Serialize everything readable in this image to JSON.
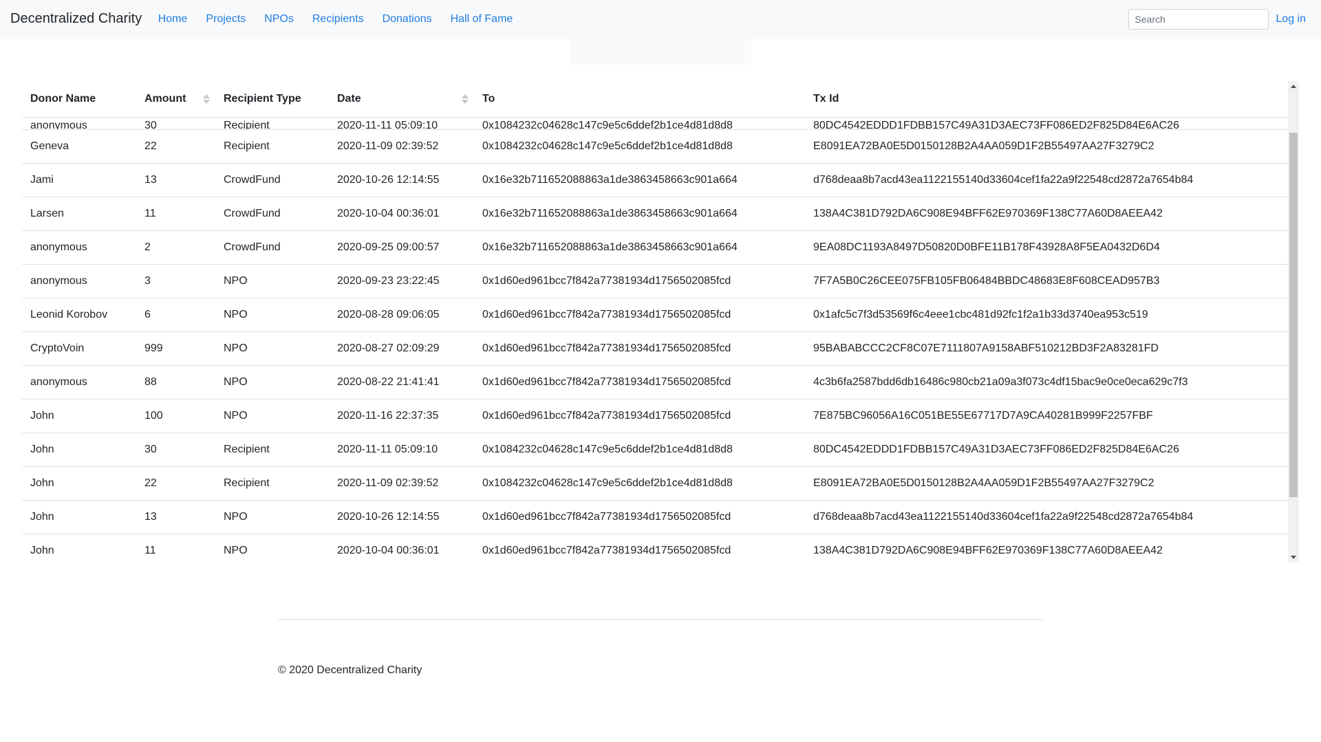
{
  "nav": {
    "brand": "Decentralized Charity",
    "links": [
      "Home",
      "Projects",
      "NPOs",
      "Recipients",
      "Donations",
      "Hall of Fame"
    ],
    "search_placeholder": "Search",
    "login": "Log in"
  },
  "table": {
    "headers": [
      "Donor Name",
      "Amount",
      "Recipient Type",
      "Date",
      "To",
      "Tx Id"
    ],
    "partial_row": [
      "anonymous",
      "30",
      "Recipient",
      "2020-11-11 05:09:10",
      "0x1084232c04628c147c9e5c6ddef2b1ce4d81d8d8",
      "80DC4542EDDD1FDBB157C49A31D3AEC73FF086ED2F825D84E6AC26"
    ],
    "rows": [
      [
        "Geneva",
        "22",
        "Recipient",
        "2020-11-09 02:39:52",
        "0x1084232c04628c147c9e5c6ddef2b1ce4d81d8d8",
        "E8091EA72BA0E5D0150128B2A4AA059D1F2B55497AA27F3279C2"
      ],
      [
        "Jami",
        "13",
        "CrowdFund",
        "2020-10-26 12:14:55",
        "0x16e32b711652088863a1de3863458663c901a664",
        "d768deaa8b7acd43ea1122155140d33604cef1fa22a9f22548cd2872a7654b84"
      ],
      [
        "Larsen",
        "11",
        "CrowdFund",
        "2020-10-04 00:36:01",
        "0x16e32b711652088863a1de3863458663c901a664",
        "138A4C381D792DA6C908E94BFF62E970369F138C77A60D8AEEA42"
      ],
      [
        "anonymous",
        "2",
        "CrowdFund",
        "2020-09-25 09:00:57",
        "0x16e32b711652088863a1de3863458663c901a664",
        "9EA08DC1193A8497D50820D0BFE11B178F43928A8F5EA0432D6D4"
      ],
      [
        "anonymous",
        "3",
        "NPO",
        "2020-09-23 23:22:45",
        "0x1d60ed961bcc7f842a77381934d1756502085fcd",
        "7F7A5B0C26CEE075FB105FB06484BBDC48683E8F608CEAD957B3"
      ],
      [
        "Leonid Korobov",
        "6",
        "NPO",
        "2020-08-28 09:06:05",
        "0x1d60ed961bcc7f842a77381934d1756502085fcd",
        "0x1afc5c7f3d53569f6c4eee1cbc481d92fc1f2a1b33d3740ea953c519"
      ],
      [
        "CryptoVoin",
        "999",
        "NPO",
        "2020-08-27 02:09:29",
        "0x1d60ed961bcc7f842a77381934d1756502085fcd",
        "95BABABCCC2CF8C07E7111807A9158ABF510212BD3F2A83281FD"
      ],
      [
        "anonymous",
        "88",
        "NPO",
        "2020-08-22 21:41:41",
        "0x1d60ed961bcc7f842a77381934d1756502085fcd",
        "4c3b6fa2587bdd6db16486c980cb21a09a3f073c4df15bac9e0ce0eca629c7f3"
      ],
      [
        "John",
        "100",
        "NPO",
        "2020-11-16 22:37:35",
        "0x1d60ed961bcc7f842a77381934d1756502085fcd",
        "7E875BC96056A16C051BE55E67717D7A9CA40281B999F2257FBF"
      ],
      [
        "John",
        "30",
        "Recipient",
        "2020-11-11 05:09:10",
        "0x1084232c04628c147c9e5c6ddef2b1ce4d81d8d8",
        "80DC4542EDDD1FDBB157C49A31D3AEC73FF086ED2F825D84E6AC26"
      ],
      [
        "John",
        "22",
        "Recipient",
        "2020-11-09 02:39:52",
        "0x1084232c04628c147c9e5c6ddef2b1ce4d81d8d8",
        "E8091EA72BA0E5D0150128B2A4AA059D1F2B55497AA27F3279C2"
      ],
      [
        "John",
        "13",
        "NPO",
        "2020-10-26 12:14:55",
        "0x1d60ed961bcc7f842a77381934d1756502085fcd",
        "d768deaa8b7acd43ea1122155140d33604cef1fa22a9f22548cd2872a7654b84"
      ],
      [
        "John",
        "11",
        "NPO",
        "2020-10-04 00:36:01",
        "0x1d60ed961bcc7f842a77381934d1756502085fcd",
        "138A4C381D792DA6C908E94BFF62E970369F138C77A60D8AEEA42"
      ]
    ]
  },
  "footer": {
    "copyright": "© 2020 Decentralized Charity"
  },
  "colors": {
    "link": "#1f7de0",
    "navbar_bg": "#f8f9fa",
    "border": "#dee2e6"
  }
}
